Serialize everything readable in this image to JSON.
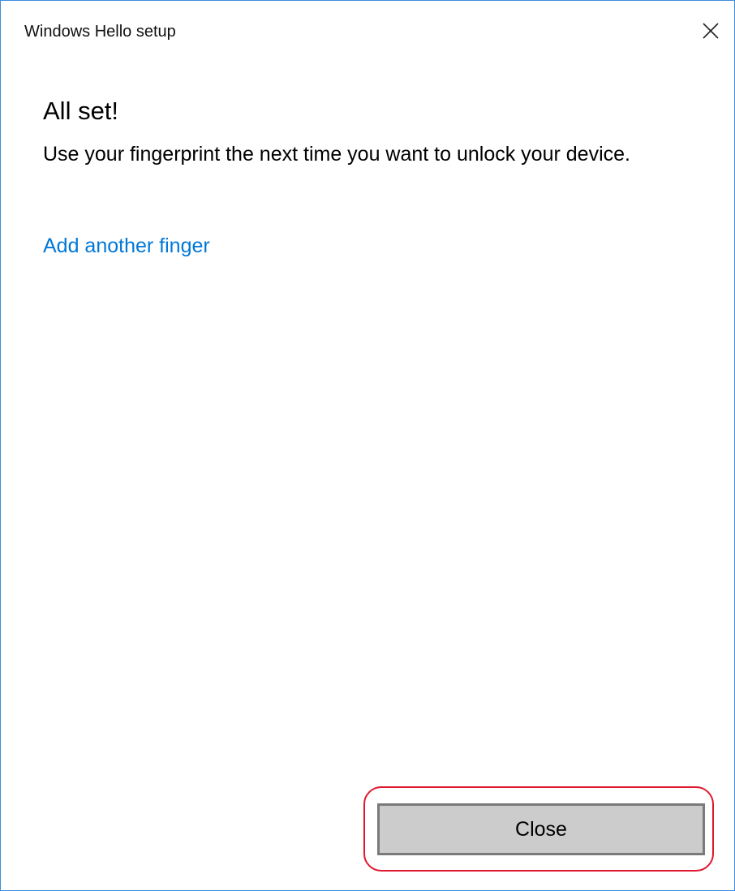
{
  "window": {
    "title": "Windows Hello setup",
    "close_icon": "close-icon"
  },
  "content": {
    "heading": "All set!",
    "description": "Use your fingerprint the next time you want to unlock your device.",
    "add_finger_link": "Add another finger"
  },
  "footer": {
    "close_button_label": "Close"
  },
  "colors": {
    "link": "#0078d7",
    "button_bg": "#cccccc",
    "button_border": "#7a7a7a",
    "highlight": "#e0182e",
    "window_border": "#3c8ddc"
  }
}
